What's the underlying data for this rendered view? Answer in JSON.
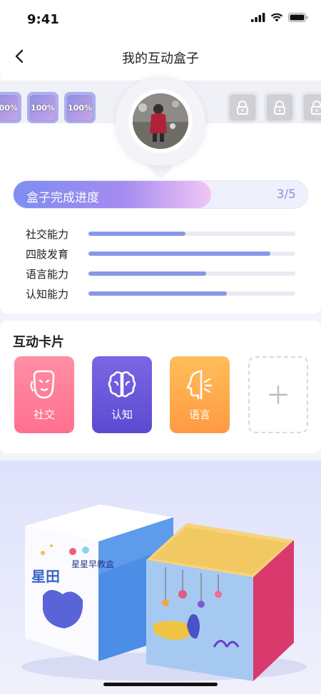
{
  "status": {
    "time": "9:41"
  },
  "nav": {
    "title": "我的互动盒子"
  },
  "badges": {
    "done_text": "100%"
  },
  "progress": {
    "label": "盒子完成进度",
    "count": "3/5",
    "fraction": 0.6
  },
  "skills": [
    {
      "name": "社交能力",
      "value": 0.47
    },
    {
      "name": "四肢发育",
      "value": 0.88
    },
    {
      "name": "语言能力",
      "value": 0.57
    },
    {
      "name": "认知能力",
      "value": 0.67
    }
  ],
  "cards_section": {
    "title": "互动卡片",
    "cards": [
      {
        "label": "社交",
        "icon": "mask-face-icon",
        "color": "#ff7a95"
      },
      {
        "label": "认知",
        "icon": "brain-icon",
        "color": "#6a58dc"
      },
      {
        "label": "语言",
        "icon": "speaking-face-icon",
        "color": "#ffaa4c"
      }
    ],
    "add_icon": "plus-icon"
  },
  "product": {
    "box_title": "星星早教盒",
    "box_brand": "星田"
  },
  "colors": {
    "accent": "#8a97e6",
    "background": "#f3f4f9"
  }
}
